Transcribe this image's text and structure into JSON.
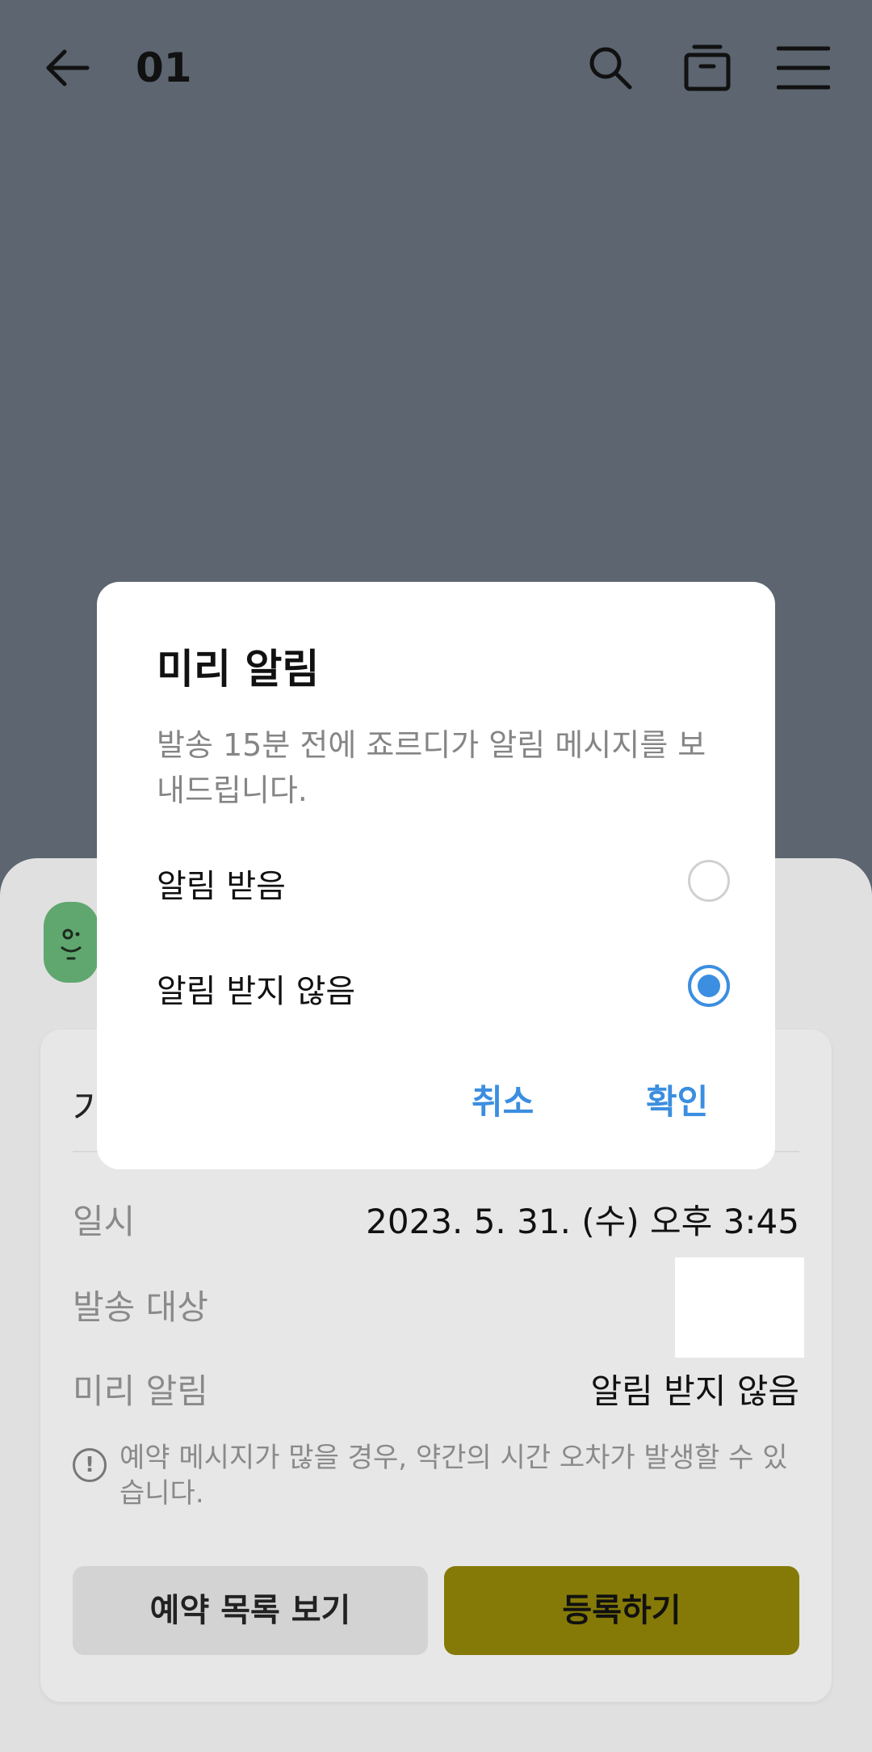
{
  "header": {
    "title": "01",
    "icons": [
      "back-arrow-icon",
      "search-icon",
      "box-icon",
      "menu-icon"
    ]
  },
  "card": {
    "heading_partial": "기",
    "rows": [
      {
        "label": "일시",
        "value": "2023. 5. 31. (수) 오후 3:45"
      },
      {
        "label": "발송 대상",
        "value": ""
      },
      {
        "label": "미리 알림",
        "value": "알림 받지 않음"
      }
    ],
    "notice": "예약 메시지가 많을 경우, 약간의 시간 오차가 발생할 수 있습니다.",
    "list_button": "예약 목록 보기",
    "register_button": "등록하기"
  },
  "dialog": {
    "title": "미리 알림",
    "description": "발송 15분 전에 죠르디가 알림 메시지를 보내드립니다.",
    "options": [
      {
        "label": "알림 받음",
        "selected": false
      },
      {
        "label": "알림 받지 않음",
        "selected": true
      }
    ],
    "cancel": "취소",
    "confirm": "확인"
  },
  "colors": {
    "accent": "#3b8ee0",
    "register_button": "#857a07",
    "overlay": "#5c6570"
  }
}
